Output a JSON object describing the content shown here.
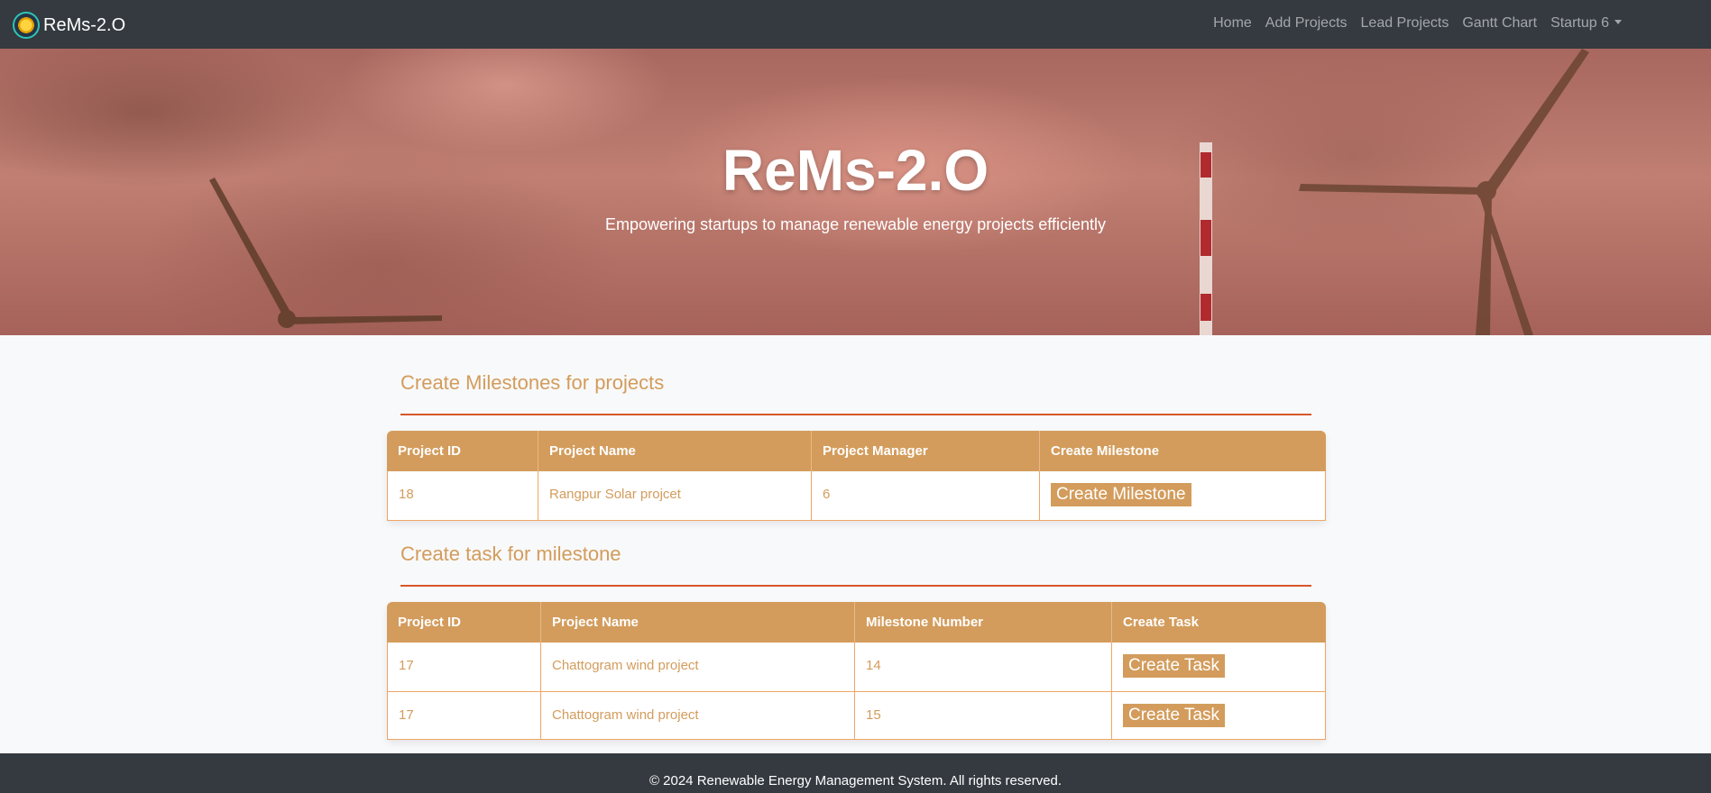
{
  "navbar": {
    "brand": "ReMs-2.O",
    "links": [
      {
        "label": "Home"
      },
      {
        "label": "Add Projects"
      },
      {
        "label": "Lead Projects"
      },
      {
        "label": "Gantt Chart"
      }
    ],
    "user_dropdown": "Startup 6"
  },
  "hero": {
    "title": "ReMs-2.O",
    "subtitle": "Empowering startups to manage renewable energy projects efficiently"
  },
  "milestones": {
    "title": "Create Milestones for projects",
    "columns": [
      "Project ID",
      "Project Name",
      "Project Manager",
      "Create Milestone"
    ],
    "rows": [
      {
        "project_id": "18",
        "project_name": "Rangpur Solar projcet",
        "project_manager": "6",
        "action": "Create Milestone"
      }
    ]
  },
  "tasks": {
    "title": "Create task for milestone",
    "columns": [
      "Project ID",
      "Project Name",
      "Milestone Number",
      "Create Task"
    ],
    "rows": [
      {
        "project_id": "17",
        "project_name": "Chattogram wind project",
        "milestone_number": "14",
        "action": "Create Task"
      },
      {
        "project_id": "17",
        "project_name": "Chattogram wind project",
        "milestone_number": "15",
        "action": "Create Task"
      }
    ]
  },
  "footer": {
    "text": "© 2024 Renewable Energy Management System. All rights reserved."
  },
  "colors": {
    "navbar": "#343a40",
    "accent": "#d39c5c",
    "rule": "#d8572a",
    "row_border": "#f0a565"
  }
}
